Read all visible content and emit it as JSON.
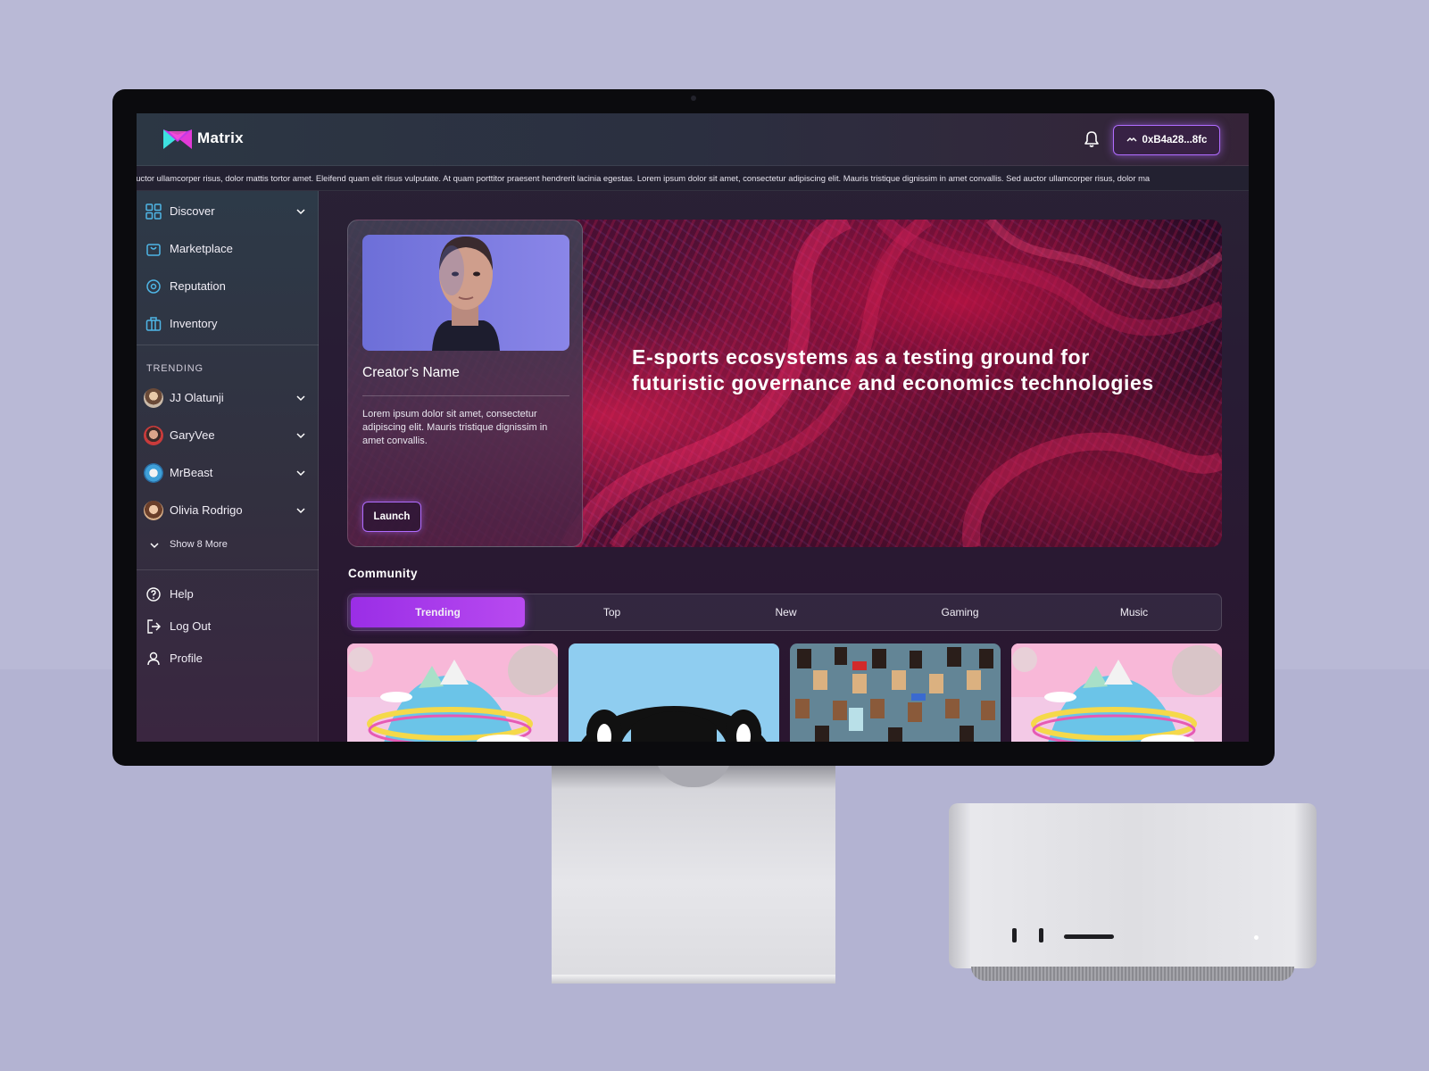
{
  "brand": {
    "name": "Matrix"
  },
  "header": {
    "wallet_address": "0xB4a28...8fc"
  },
  "ticker": {
    "text": "auctor ullamcorper risus, dolor mattis tortor amet. Eleifend quam elit risus vulputate. At quam porttitor praesent hendrerit lacinia egestas. Lorem ipsum dolor sit amet, consectetur adipiscing elit. Mauris tristique dignissim in amet convallis. Sed auctor ullamcorper risus, dolor ma"
  },
  "sidebar": {
    "nav": [
      {
        "label": "Discover",
        "icon": "grid-icon"
      },
      {
        "label": "Marketplace",
        "icon": "shopping-bag-icon"
      },
      {
        "label": "Reputation",
        "icon": "target-icon"
      },
      {
        "label": "Inventory",
        "icon": "box-icon"
      }
    ],
    "trending_title": "TRENDING",
    "trending": [
      {
        "label": "JJ Olatunji"
      },
      {
        "label": "GaryVee"
      },
      {
        "label": "MrBeast"
      },
      {
        "label": "Olivia Rodrigo"
      }
    ],
    "show_more": "Show 8 More",
    "footer": [
      {
        "label": "Help",
        "icon": "help-icon"
      },
      {
        "label": "Log Out",
        "icon": "logout-icon"
      },
      {
        "label": "Profile",
        "icon": "user-icon"
      }
    ]
  },
  "hero": {
    "title": "E-sports ecosystems as a testing ground for futuristic governance and economics technologies",
    "creator_name": "Creator’s Name",
    "description": "Lorem ipsum dolor sit amet, consectetur adipiscing elit. Mauris tristique dignissim in amet convallis.",
    "launch_label": "Launch"
  },
  "community": {
    "title": "Community",
    "tabs": [
      "Trending",
      "Top",
      "New",
      "Gaming",
      "Music"
    ],
    "active_tab": "Trending"
  },
  "colors": {
    "accent": "#b06cff",
    "active_tab": "#a63be9",
    "background": "#b9b9d6"
  }
}
